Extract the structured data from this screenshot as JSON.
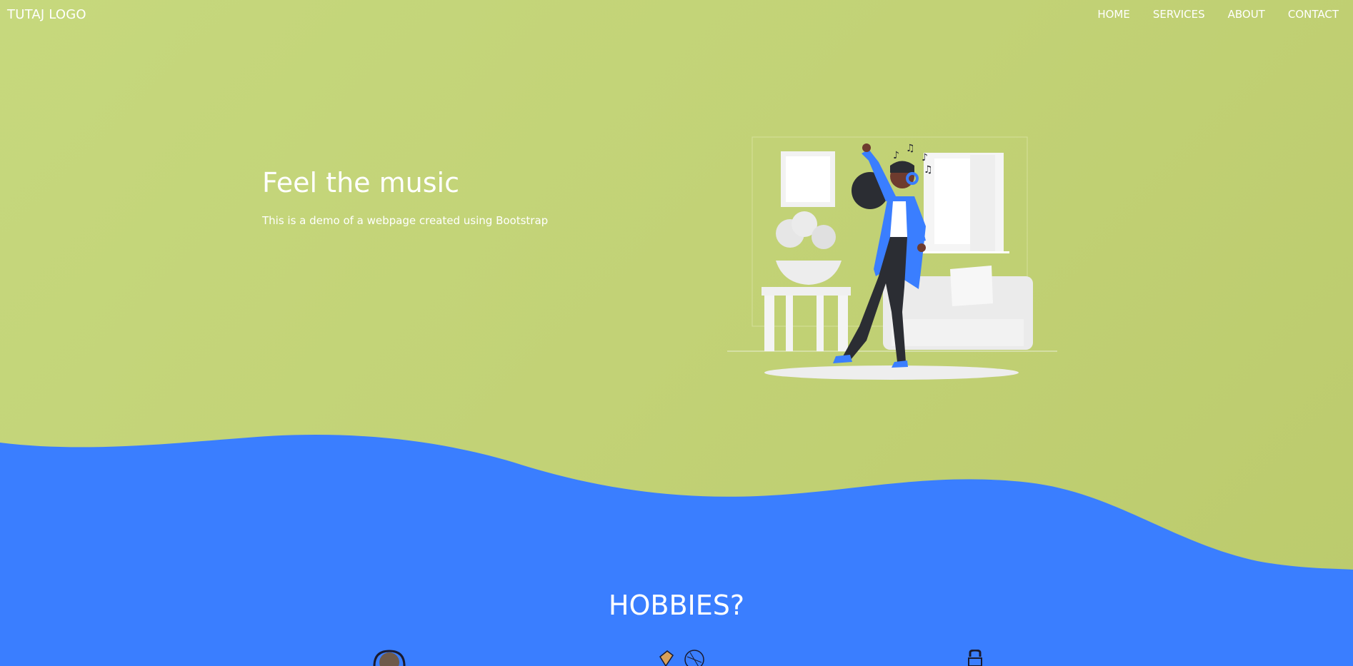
{
  "navbar": {
    "brand": "TUTAJ LOGO",
    "links": [
      "HOME",
      "SERVICES",
      "ABOUT",
      "CONTACT"
    ]
  },
  "hero": {
    "title": "Feel the music",
    "subtitle": "This is a demo of a webpage created using Bootstrap",
    "illustration": "person-dancing-with-headphones-illustration"
  },
  "hobbies": {
    "title": "HOBBIES?",
    "icons": [
      "headphones-icon",
      "sports-icon",
      "kettlebell-icon"
    ]
  },
  "colors": {
    "hero_background": "#c2d276",
    "wave_blue": "#3a7eff",
    "text": "#ffffff"
  }
}
